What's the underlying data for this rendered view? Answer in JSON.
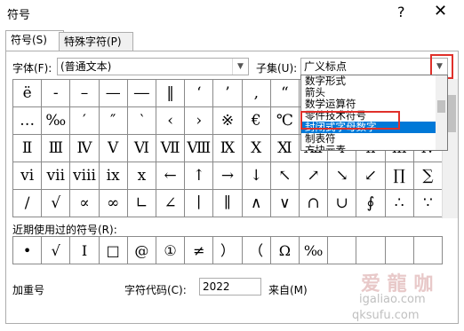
{
  "window": {
    "title": "符号",
    "help": "?",
    "close": "✕"
  },
  "tabs": [
    {
      "label": "符号(S)"
    },
    {
      "label": "特殊字符(P)"
    }
  ],
  "font": {
    "label": "字体(F):",
    "value": "(普通文本)"
  },
  "subset": {
    "label": "子集(U):",
    "value": "广义标点"
  },
  "dropdown": {
    "items": [
      "数字形式",
      "箭头",
      "数学运算符",
      "零件技术符号",
      "封闭式字母数字",
      "制表符",
      "方块元素"
    ],
    "highlighted_index": 4
  },
  "symbols": [
    [
      "ë",
      "-",
      "–",
      "—",
      "―",
      "‖",
      "‘",
      "’",
      "‚",
      "“",
      "”",
      "„",
      "†",
      "‡",
      "•"
    ],
    [
      "…",
      "‰",
      "′",
      "″",
      "‵",
      "‹",
      "›",
      "※",
      "€",
      "℃",
      "℅",
      "℉",
      "№",
      "℡",
      "™"
    ],
    [
      "Ⅱ",
      "Ⅲ",
      "Ⅳ",
      "Ⅴ",
      "Ⅵ",
      "Ⅶ",
      "Ⅷ",
      "Ⅸ",
      "Ⅹ",
      "Ⅺ",
      "Ⅻ",
      "ⅰ",
      "ⅱ",
      "ⅲ",
      "ⅳ"
    ],
    [
      "ⅵ",
      "ⅶ",
      "ⅷ",
      "ⅸ",
      "ⅹ",
      "←",
      "↑",
      "→",
      "↓",
      "↖",
      "↗",
      "↘",
      "↙",
      "∏",
      "∑"
    ],
    [
      "∕",
      "√",
      "∝",
      "∞",
      "∟",
      "∠",
      "∣",
      "∥",
      "∧",
      "∨",
      "∩",
      "∪",
      "∮",
      "∴",
      "∵"
    ]
  ],
  "recent": {
    "label": "近期使用过的符号(R):",
    "items": [
      "•",
      "√",
      "Ⅰ",
      "□",
      "@",
      "①",
      "≠",
      "）",
      "（",
      "Ω",
      "‰",
      "",
      "",
      "",
      ""
    ]
  },
  "status": {
    "name": "加重号",
    "code_label": "字符代码(C):",
    "code_value": "2022",
    "from_label": "来自(M)"
  },
  "watermark": {
    "line1": "爱 龍 咖",
    "line2": "igaliao.com",
    "line3": "qksufu.com"
  }
}
